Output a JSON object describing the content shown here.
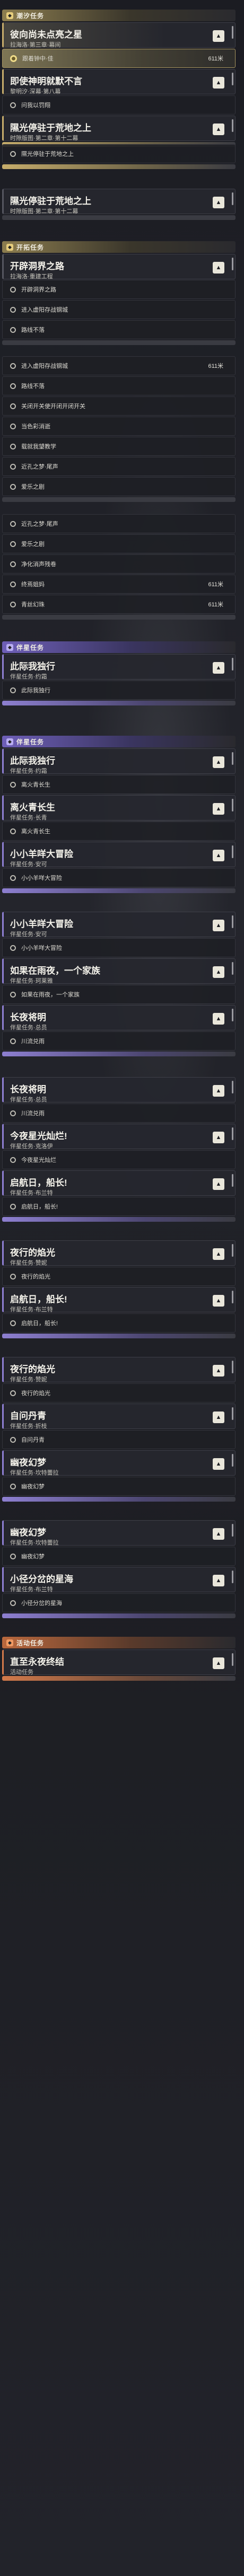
{
  "dividers": {
    "tide": "潮汐任务",
    "world1": "开拓任务",
    "comp1": "伴星任务",
    "comp2": "伴星任务",
    "event": "活动任务"
  },
  "cards": [
    {
      "title": "彼向尚未点亮之星",
      "sub": "拉海洛·第三章·幕间"
    },
    {
      "title": "即使神明就默不言",
      "sub": "黎明汐·深幕·第八幕"
    },
    {
      "title": "隰光停驻于荒地之上",
      "sub": "时隙版图·第二章·第十二幕"
    },
    {
      "title": "隰光停驻于荒地之上",
      "sub": "时隙版图·第二章·第十二幕"
    },
    {
      "title": "开辟洞界之路",
      "sub": "拉海洛·重建工程"
    },
    {
      "title": "此际我独行",
      "sub": "伴星任务·约霜"
    },
    {
      "title": "此际我独行",
      "sub": "伴星任务·约霜"
    },
    {
      "title": "离火青长生",
      "sub": "伴星任务·长青"
    },
    {
      "title": "小小羊咩大冒险",
      "sub": "伴星任务·安可"
    },
    {
      "title": "小小羊咩大冒险",
      "sub": "伴星任务·安可"
    },
    {
      "title": "如果在雨夜，一个家族",
      "sub": "伴星任务·珂莱雅"
    },
    {
      "title": "长夜将明",
      "sub": "伴星任务·总员"
    },
    {
      "title": "长夜将明",
      "sub": "伴星任务·总员"
    },
    {
      "title": "今夜星光灿烂!",
      "sub": "伴星任务·克洛伊"
    },
    {
      "title": "启航日，船长!",
      "sub": "伴星任务·布兰特"
    },
    {
      "title": "夜行的焰光",
      "sub": "伴星任务·赞妮"
    },
    {
      "title": "启航日，船长!",
      "sub": "伴星任务·布兰特"
    },
    {
      "title": "夜行的焰光",
      "sub": "伴星任务·赞妮"
    },
    {
      "title": "自问丹青",
      "sub": "伴星任务·折枝"
    },
    {
      "title": "幽夜幻梦",
      "sub": "伴星任务·坎特蕾拉"
    },
    {
      "title": "幽夜幻梦",
      "sub": "伴星任务·坎特蕾拉"
    },
    {
      "title": "小径分岔的星海",
      "sub": "伴星任务·布兰特"
    },
    {
      "title": "直至永夜终结",
      "sub": "活动任务"
    }
  ],
  "rows": [
    {
      "label": "跟着钟中·佳",
      "dist": "611米"
    },
    {
      "label": "问我以罚翔"
    },
    {
      "label": "隰光停驻于荒地之上"
    },
    {
      "label": "开辟洞界之路"
    },
    {
      "label": "进入虚阳存战钢城"
    },
    {
      "label": "路线不落"
    },
    {
      "label": "进入虚阳存战钢城",
      "dist": "611米"
    },
    {
      "label": "路线不落"
    },
    {
      "label": "关闭开关使开闭开闭开关"
    },
    {
      "label": "当色彩消逝"
    },
    {
      "label": "载就我望教学"
    },
    {
      "label": "近孔之梦·尾声"
    },
    {
      "label": "爱乐之剧"
    },
    {
      "label": "近孔之梦·尾声"
    },
    {
      "label": "爱乐之剧"
    },
    {
      "label": "净化消声残卷"
    },
    {
      "label": "终焉姐妈",
      "dist": "611米"
    },
    {
      "label": "青丝幻珠",
      "dist": "611米"
    },
    {
      "label": "此际我独行"
    },
    {
      "label": "离火青长生"
    },
    {
      "label": "小小羊咩大冒险"
    },
    {
      "label": "小小羊咩大冒险"
    },
    {
      "label": "如果在雨夜，一个家族"
    },
    {
      "label": "川流兑雨"
    },
    {
      "label": "川流兑雨"
    },
    {
      "label": "今夜星光灿烂"
    },
    {
      "label": "启航日，船长!"
    },
    {
      "label": "夜行的焰光"
    },
    {
      "label": "启航日，船长!"
    },
    {
      "label": "夜行的焰光"
    },
    {
      "label": "自问丹青"
    },
    {
      "label": "幽夜幻梦"
    },
    {
      "label": "幽夜幻梦"
    },
    {
      "label": "小径分岔的星海"
    }
  ],
  "icons": {
    "expand": "chevron-up-icon",
    "task": "circle-ring-icon",
    "divider": "quest-category-icon"
  },
  "colors": {
    "tide": "#c9ae6c",
    "companion": "#8f80d4",
    "event": "#d47a4b"
  }
}
